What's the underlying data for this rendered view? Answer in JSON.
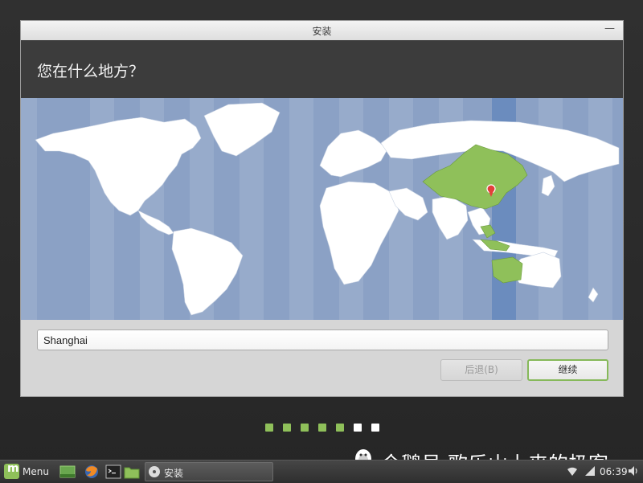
{
  "window": {
    "title": "安装",
    "close_glyph": "—"
  },
  "header": {
    "question": "您在什么地方？"
  },
  "map": {
    "ocean_color": "#8ba1c5",
    "land_color": "#ffffff",
    "highlight_color": "#8fc05a",
    "timezone_band_color": "#6b8cbe",
    "pin_color": "#e2403a",
    "pin_icon": "map-pin-icon"
  },
  "location": {
    "city_value": "Shanghai"
  },
  "buttons": {
    "back_label": "后退(B)",
    "next_label": "继续"
  },
  "progress": {
    "total_steps": 7,
    "completed_steps": 5
  },
  "taskbar": {
    "menu_label": "Menu",
    "launchers": [
      "show-desktop-icon",
      "firefox-icon",
      "terminal-icon",
      "files-icon"
    ],
    "window_button_label": "安装",
    "clock": "06:39"
  },
  "watermark": {
    "text": "企鹅号 歌乐山上来的极客"
  }
}
